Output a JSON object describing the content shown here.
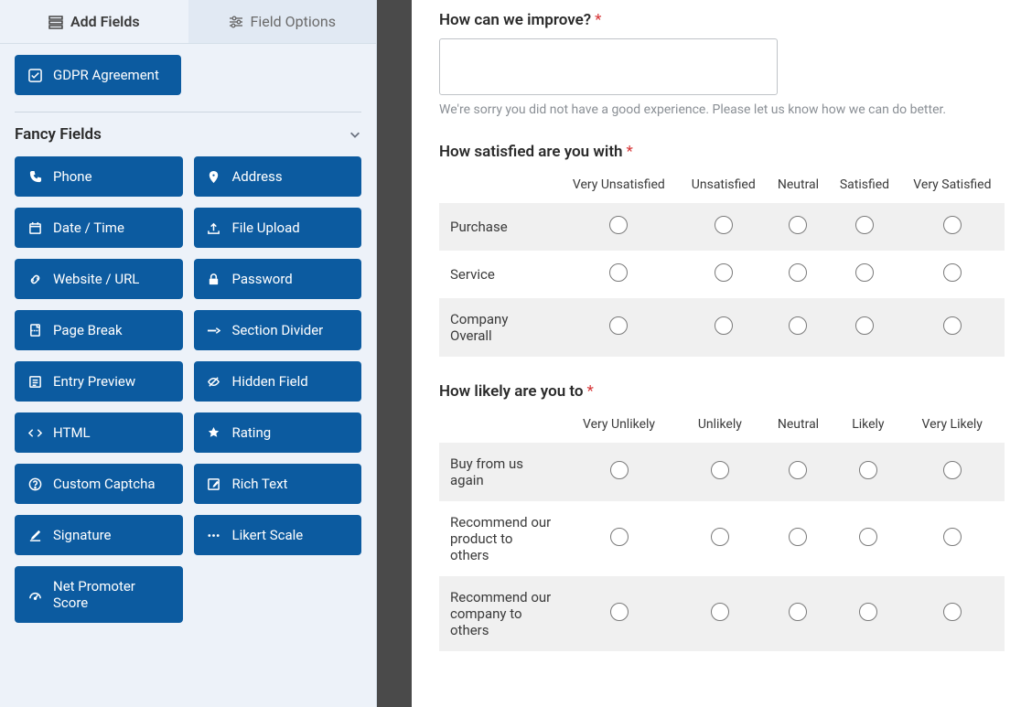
{
  "tabs": {
    "add_fields": "Add Fields",
    "field_options": "Field Options"
  },
  "top_field": {
    "label": "GDPR Agreement"
  },
  "section": {
    "title": "Fancy Fields"
  },
  "fields": [
    {
      "icon": "phone",
      "label": "Phone"
    },
    {
      "icon": "address",
      "label": "Address"
    },
    {
      "icon": "date",
      "label": "Date / Time"
    },
    {
      "icon": "upload",
      "label": "File Upload"
    },
    {
      "icon": "link",
      "label": "Website / URL"
    },
    {
      "icon": "lock",
      "label": "Password"
    },
    {
      "icon": "pagebreak",
      "label": "Page Break"
    },
    {
      "icon": "divider",
      "label": "Section Divider"
    },
    {
      "icon": "preview",
      "label": "Entry Preview"
    },
    {
      "icon": "hidden",
      "label": "Hidden Field"
    },
    {
      "icon": "html",
      "label": "HTML"
    },
    {
      "icon": "star",
      "label": "Rating"
    },
    {
      "icon": "captcha",
      "label": "Custom Captcha"
    },
    {
      "icon": "richtext",
      "label": "Rich Text"
    },
    {
      "icon": "signature",
      "label": "Signature"
    },
    {
      "icon": "likert",
      "label": "Likert Scale"
    },
    {
      "icon": "nps",
      "label": "Net Promoter Score"
    }
  ],
  "q1": {
    "label": "How can we improve?",
    "hint": "We're sorry you did not have a good experience. Please let us know how we can do better."
  },
  "q2": {
    "label": "How satisfied are you with",
    "cols": [
      "Very Unsatisfied",
      "Unsatisfied",
      "Neutral",
      "Satisfied",
      "Very Satisfied"
    ],
    "rows": [
      "Purchase",
      "Service",
      "Company Overall"
    ]
  },
  "q3": {
    "label": "How likely are you to",
    "cols": [
      "Very Unlikely",
      "Unlikely",
      "Neutral",
      "Likely",
      "Very Likely"
    ],
    "rows": [
      "Buy from us again",
      "Recommend our product to others",
      "Recommend our company to others"
    ]
  }
}
